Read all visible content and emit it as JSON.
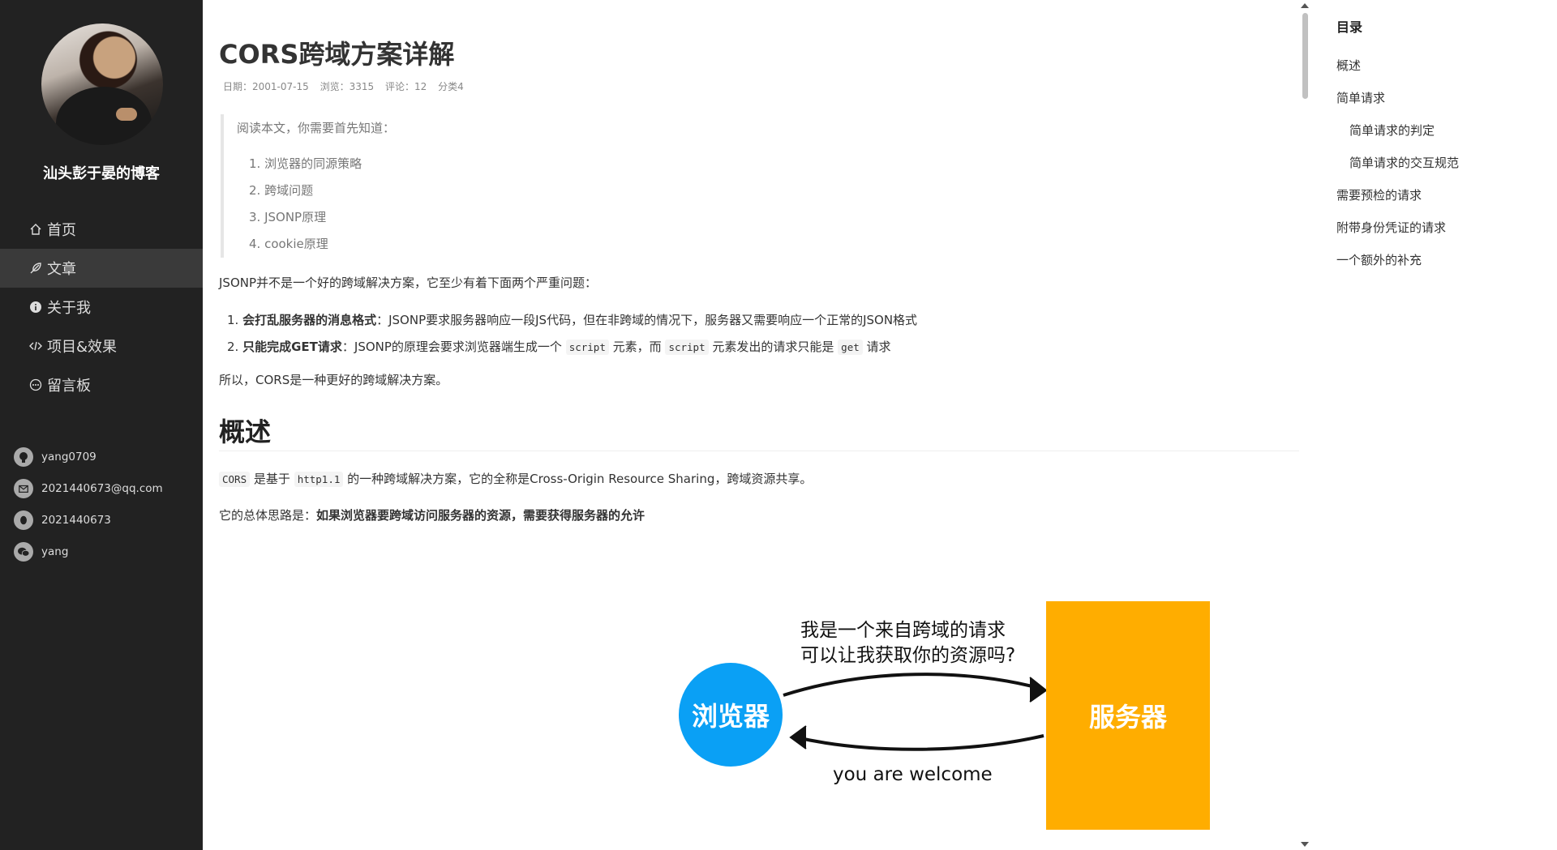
{
  "sidebar": {
    "site_name": "汕头彭于晏的博客",
    "nav": [
      {
        "label": "首页",
        "icon": "home-icon"
      },
      {
        "label": "文章",
        "icon": "feather-icon"
      },
      {
        "label": "关于我",
        "icon": "info-icon"
      },
      {
        "label": "项目&效果",
        "icon": "code-icon"
      },
      {
        "label": "留言板",
        "icon": "chat-icon"
      }
    ],
    "contacts": [
      {
        "label": "yang0709",
        "icon": "github-icon"
      },
      {
        "label": "2021440673@qq.com",
        "icon": "mail-icon"
      },
      {
        "label": "2021440673",
        "icon": "qq-icon"
      },
      {
        "label": "yang",
        "icon": "wechat-icon"
      }
    ]
  },
  "article": {
    "title": "CORS跨域方案详解",
    "meta": {
      "date": "日期：2001-07-15",
      "views": "浏览：3315",
      "comments": "评论：12",
      "category": "分类4"
    },
    "quote": {
      "intro": "阅读本文，你需要首先知道：",
      "items": [
        "1. 浏览器的同源策略",
        "2. 跨域问题",
        "3. JSONP原理",
        "4. cookie原理"
      ]
    },
    "p1": "JSONP并不是一个好的跨域解决方案，它至少有着下面两个严重问题：",
    "problems": [
      {
        "num": "1.",
        "bold": "会打乱服务器的消息格式",
        "text": "：JSONP要求服务器响应一段JS代码，但在非跨域的情况下，服务器又需要响应一个正常的JSON格式"
      },
      {
        "num": "2.",
        "bold": "只能完成GET请求",
        "t1": "：JSONP的原理会要求浏览器端生成一个",
        "c1": "script",
        "t2": "元素，而",
        "c2": "script",
        "t3": "元素发出的请求只能是",
        "c3": "get",
        "t4": "请求"
      }
    ],
    "p2": "所以，CORS是一种更好的跨域解决方案。",
    "h1": "概述",
    "p3": {
      "c1": "CORS",
      "t1": "是基于",
      "c2": "http1.1",
      "t2": "的一种跨域解决方案，它的全称是Cross-Origin Resource Sharing，跨域资源共享。"
    },
    "p4": {
      "t1": "它的总体思路是：",
      "bold": "如果浏览器要跨域访问服务器的资源，需要获得服务器的允许"
    },
    "diagram": {
      "browser": "浏览器",
      "server": "服务器",
      "request_line1": "我是一个来自跨域的请求",
      "request_line2": "可以让我获取你的资源吗?",
      "response": "you are welcome",
      "browser_color": "#0aa0f5",
      "server_color": "#ffad00"
    }
  },
  "toc": {
    "title": "目录",
    "items": [
      {
        "label": "概述"
      },
      {
        "label": "简单请求"
      },
      {
        "label": "简单请求的判定"
      },
      {
        "label": "简单请求的交互规范"
      },
      {
        "label": "需要预检的请求"
      },
      {
        "label": "附带身份凭证的请求"
      },
      {
        "label": "一个额外的补充"
      }
    ]
  }
}
